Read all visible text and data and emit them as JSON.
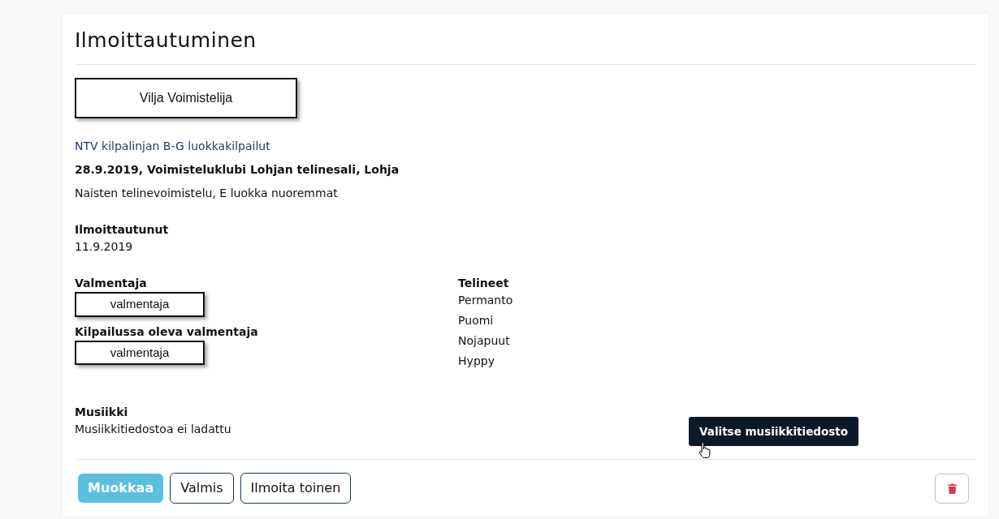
{
  "title": "Ilmoittautuminen",
  "gymnast": "Vilja Voimistelija",
  "competition": {
    "name": "NTV kilpalinjan B-G luokkakilpailut",
    "date_place": "28.9.2019, Voimisteluklubi Lohjan telinesali, Lohja",
    "category": "Naisten telinevoimistelu, E luokka nuoremmat"
  },
  "registered": {
    "label": "Ilmoittautunut",
    "value": "11.9.2019"
  },
  "coach": {
    "label": "Valmentaja",
    "value": "valmentaja"
  },
  "coach_at_competition": {
    "label": "Kilpailussa oleva valmentaja",
    "value": "valmentaja"
  },
  "apparatus": {
    "label": "Telineet",
    "items": [
      "Permanto",
      "Puomi",
      "Nojapuut",
      "Hyppy"
    ]
  },
  "music": {
    "label": "Musiikki",
    "value": "Musiikkitiedostoa ei ladattu",
    "button": "Valitse musiikkitiedosto"
  },
  "buttons": [
    {
      "label": "Muokkaa",
      "kind": "filled"
    },
    {
      "label": "Valmis",
      "kind": "outline"
    },
    {
      "label": "Ilmoita toinen",
      "kind": "outline"
    }
  ]
}
